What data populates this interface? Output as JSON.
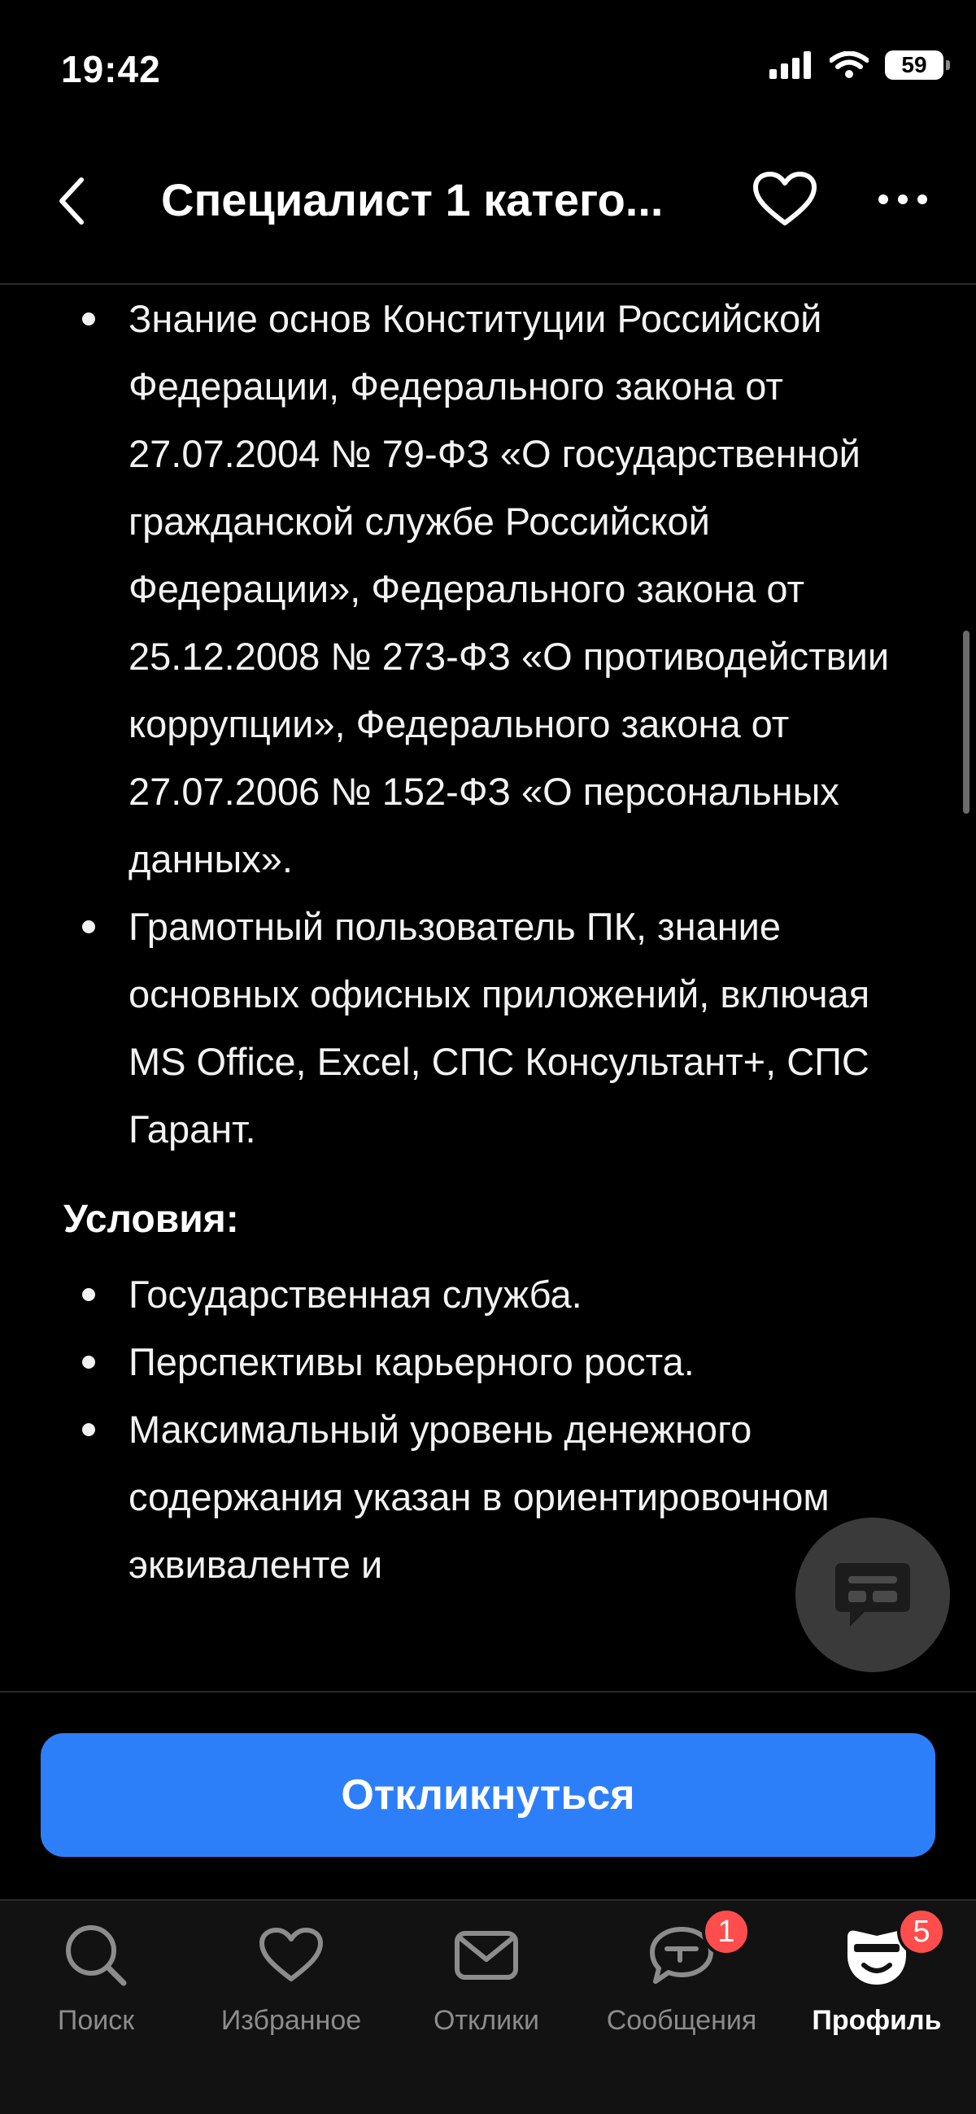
{
  "status": {
    "time": "19:42",
    "battery": "59"
  },
  "nav": {
    "title": "Специалист 1 катего..."
  },
  "requirements_list": [
    "Знание основ Конституции Российской Федерации, Федерального закона от 27.07.2004 № 79-ФЗ «О государственной гражданской службе Российской Федерации», Федерального закона от 25.12.2008 № 273-ФЗ «О противодействии коррупции», Федерального закона от 27.07.2006 № 152-ФЗ «О персональных данных».",
    "Грамотный пользователь ПК, знание основных офисных приложений, включая MS Office, Excel, СПС Консультант+, СПС Гарант."
  ],
  "conditions": {
    "heading": "Условия:",
    "items": [
      "Государственная служба.",
      "Перспективы карьерного роста.",
      "Максимальный уровень денежного содержания указан в ориентировочном эквиваленте и"
    ]
  },
  "cta": {
    "label": "Откликнуться"
  },
  "tabs": [
    {
      "label": "Поиск",
      "icon": "search-icon"
    },
    {
      "label": "Избранное",
      "icon": "heart-icon"
    },
    {
      "label": "Отклики",
      "icon": "envelope-icon"
    },
    {
      "label": "Сообщения",
      "icon": "chat-icon",
      "badge": "1"
    },
    {
      "label": "Профиль",
      "icon": "profile-mascot-icon",
      "badge": "5"
    }
  ],
  "colors": {
    "accent": "#2d7ff9",
    "badge": "#ff4d4d",
    "background": "#000000"
  }
}
